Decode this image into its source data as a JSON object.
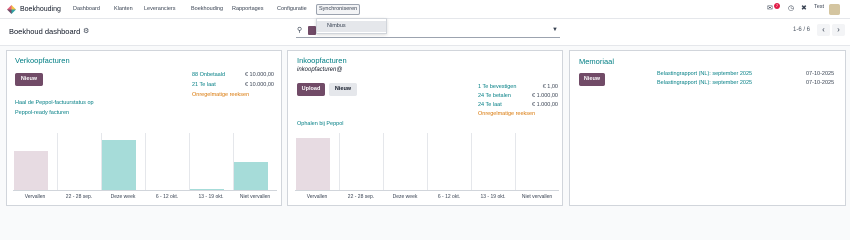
{
  "app": {
    "name": "Boekhouding"
  },
  "menu": [
    "Dashboard",
    "Klanten",
    "Leveranciers",
    "Boekhouding",
    "Rapportages",
    "Configuratie",
    "Synchroniseren"
  ],
  "dropdown": {
    "item": "Nimbus"
  },
  "topright": {
    "badge": "7",
    "user": "Test"
  },
  "control": {
    "title": "Boekhoud dashboard",
    "pager": "1-6 / 6"
  },
  "cards": {
    "sales": {
      "title": "Verkoopfacturen",
      "new_label": "Nieuw",
      "link1": "Haal de Peppol-factuurstatus op",
      "link2": "Peppol-ready facturen",
      "stats": [
        {
          "label": "88 Onbetaald",
          "amount": "€ 10.000,00"
        },
        {
          "label": "21 Te laat",
          "amount": "€ 10.000,00"
        }
      ],
      "warning": "Onregelmatige reeksen",
      "xlabels": [
        "Vervallen",
        "22 - 28 sep.",
        "Deze week",
        "6 - 12 okt.",
        "13 - 19 okt.",
        "Niet vervallen"
      ],
      "bars": [
        0.68,
        0,
        0.86,
        0,
        0.02,
        0.48
      ]
    },
    "purchase": {
      "title": "Inkoopfacturen",
      "subtitle": "inkoopfacturen@",
      "upload_label": "Upload",
      "new_label": "Nieuw",
      "link": "Ophalen bij Peppol",
      "stats": [
        {
          "label": "1 Te bevestigen",
          "amount": "€ 1,00"
        },
        {
          "label": "24 Te betalen",
          "amount": "€ 1.000,00"
        },
        {
          "label": "24 Te laat",
          "amount": "€ 1.000,00"
        }
      ],
      "warning": "Onregelmatige reeksen",
      "xlabels": [
        "Vervallen",
        "22 - 28 sep.",
        "Deze week",
        "6 - 12 okt.",
        "13 - 19 okt.",
        "Niet vervallen"
      ],
      "bars": [
        0.9,
        0,
        0,
        0,
        0,
        0
      ]
    },
    "memorial": {
      "title": "Memoriaal",
      "new_label": "Nieuw",
      "rows": [
        {
          "label": "Belastingrapport (NL): september 2025",
          "date": "07-10-2025"
        },
        {
          "label": "Belastingrapport (NL): september 2025",
          "date": "07-10-2025"
        }
      ]
    }
  },
  "colors": {
    "accent": "#714b67",
    "link": "#017e84",
    "bar_pink": "#e7dbe2",
    "bar_teal": "#a6dcd9",
    "warning": "#d97706"
  }
}
